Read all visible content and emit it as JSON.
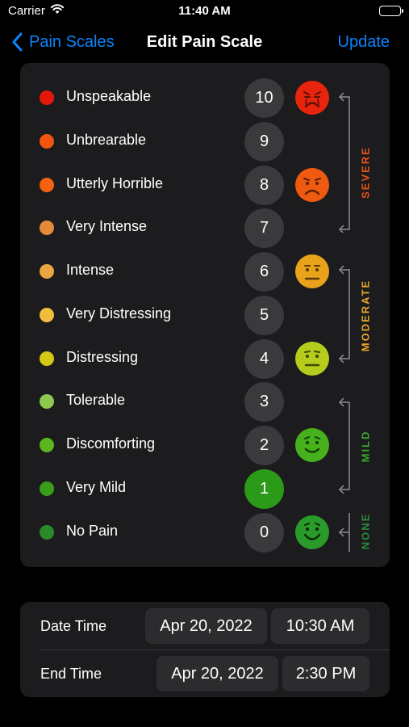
{
  "status_bar": {
    "carrier": "Carrier",
    "time": "11:40 AM"
  },
  "nav": {
    "back_label": "Pain Scales",
    "title": "Edit Pain Scale",
    "update_label": "Update"
  },
  "scale": {
    "rows": [
      {
        "label": "Unspeakable",
        "value": "10",
        "dot_color": "#e3170a",
        "face": "crying",
        "face_color": "#e8240c"
      },
      {
        "label": "Unbrearable",
        "value": "9",
        "dot_color": "#f2550f"
      },
      {
        "label": "Utterly Horrible",
        "value": "8",
        "dot_color": "#f2620f",
        "face": "sad",
        "face_color": "#ef5a10"
      },
      {
        "label": "Very Intense",
        "value": "7",
        "dot_color": "#e58a3a"
      },
      {
        "label": "Intense",
        "value": "6",
        "dot_color": "#eba542",
        "face": "neutral-frown",
        "face_color": "#e9a31a"
      },
      {
        "label": "Very Distressing",
        "value": "5",
        "dot_color": "#f0bd3e"
      },
      {
        "label": "Distressing",
        "value": "4",
        "dot_color": "#d5c815",
        "face": "neutral",
        "face_color": "#b6cc1d"
      },
      {
        "label": "Tolerable",
        "value": "3",
        "dot_color": "#8dc94f"
      },
      {
        "label": "Discomforting",
        "value": "2",
        "dot_color": "#5bb51f",
        "face": "smile",
        "face_color": "#46b11d"
      },
      {
        "label": "Very Mild",
        "value": "1",
        "dot_color": "#3a9c1b",
        "selected": true
      },
      {
        "label": "No Pain",
        "value": "0",
        "dot_color": "#2a8a2a",
        "face": "big-smile",
        "face_color": "#2a9a2a"
      }
    ],
    "selected_value": "1",
    "categories": [
      {
        "label": "SEVERE",
        "color": "#e8521a"
      },
      {
        "label": "MODERATE",
        "color": "#e5a52a"
      },
      {
        "label": "MILD",
        "color": "#3aa62a"
      },
      {
        "label": "NONE",
        "color": "#2a8a3a"
      }
    ]
  },
  "times": {
    "start": {
      "label": "Date Time",
      "date": "Apr 20, 2022",
      "time": "10:30 AM"
    },
    "end": {
      "label": "End Time",
      "date": "Apr 20, 2022",
      "time": "2:30 PM"
    }
  }
}
